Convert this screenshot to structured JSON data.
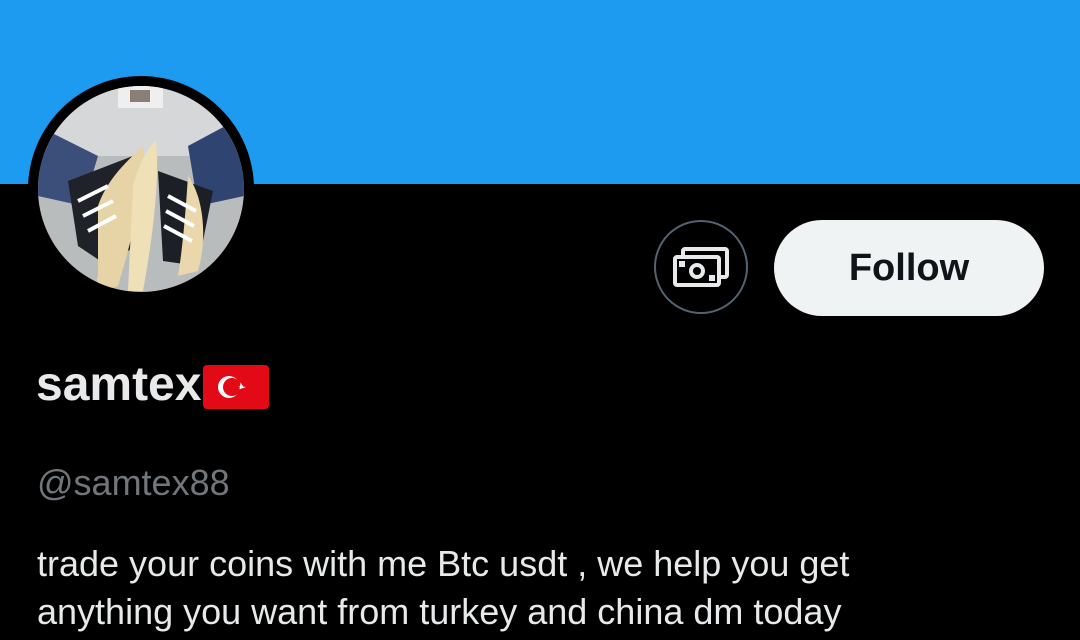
{
  "profile": {
    "display_name": "samtex",
    "flag": "flag-turkey",
    "handle": "@samtex88",
    "bio_lines": [
      "trade your coins with me Btc usdt , we help you get",
      "anything you want from turkey and china dm today"
    ]
  },
  "actions": {
    "tip_icon": "money-icon",
    "follow_label": "Follow"
  },
  "colors": {
    "banner": "#1d9bf0",
    "background": "#000000",
    "follow_bg": "#eff3f4",
    "handle_text": "#71767b",
    "primary_text": "#e7e9ea"
  }
}
